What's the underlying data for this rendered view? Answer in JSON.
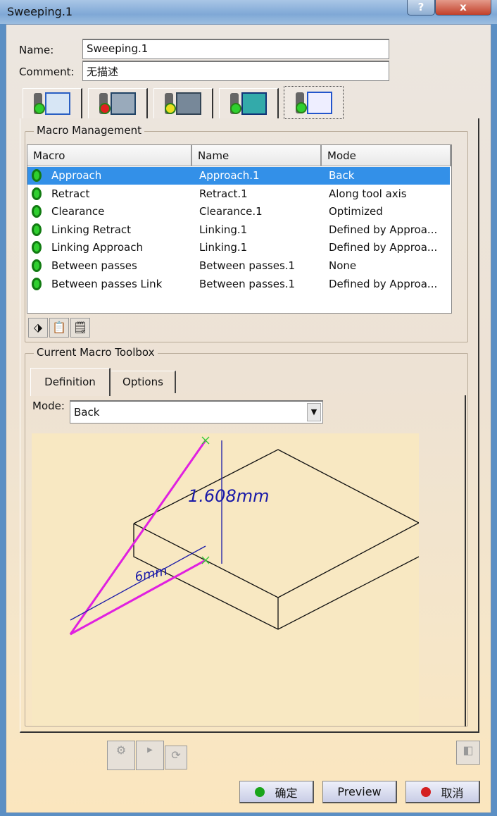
{
  "window": {
    "title": "Sweeping.1",
    "help": "?",
    "close": "x"
  },
  "form": {
    "name_label": "Name:",
    "name_value": "Sweeping.1",
    "comment_label": "Comment:",
    "comment_value": "无描述"
  },
  "tabs": [
    {
      "icon": "geometry-tab-icon",
      "status": "green"
    },
    {
      "icon": "strategy-tab-icon",
      "status": "red"
    },
    {
      "icon": "tool-tab-icon",
      "status": "yellow"
    },
    {
      "icon": "feeds-speeds-tab-icon",
      "status": "green"
    },
    {
      "icon": "macros-tab-icon",
      "status": "green",
      "active": true
    }
  ],
  "macro_management": {
    "title": "Macro Management",
    "columns": [
      "Macro",
      "Name",
      "Mode"
    ],
    "rows": [
      {
        "macro": "Approach",
        "name": "Approach.1",
        "mode": "Back",
        "selected": true
      },
      {
        "macro": "Retract",
        "name": "Retract.1",
        "mode": "Along tool axis"
      },
      {
        "macro": "Clearance",
        "name": "Clearance.1",
        "mode": "Optimized"
      },
      {
        "macro": "Linking Retract",
        "name": "Linking.1",
        "mode": "Defined by Approa..."
      },
      {
        "macro": "Linking Approach",
        "name": "Linking.1",
        "mode": "Defined by Approa..."
      },
      {
        "macro": "Between passes",
        "name": "Between passes.1",
        "mode": "None"
      },
      {
        "macro": "Between passes Link",
        "name": "Between passes.1",
        "mode": "Defined by Approa..."
      }
    ],
    "tools": [
      "edit-icon",
      "paste-icon",
      "properties-icon"
    ]
  },
  "toolbox": {
    "title": "Current Macro Toolbox",
    "tabs": [
      "Definition",
      "Options"
    ],
    "mode_label": "Mode:",
    "mode_value": "Back",
    "diagram": {
      "height_label": "1.608mm",
      "distance_label": "6mm"
    }
  },
  "bottom": {
    "ok": "确定",
    "preview": "Preview",
    "cancel": "取消",
    "colors": {
      "ok": "#1aa51a",
      "cancel": "#d42020",
      "selection": "#3390e8"
    }
  }
}
